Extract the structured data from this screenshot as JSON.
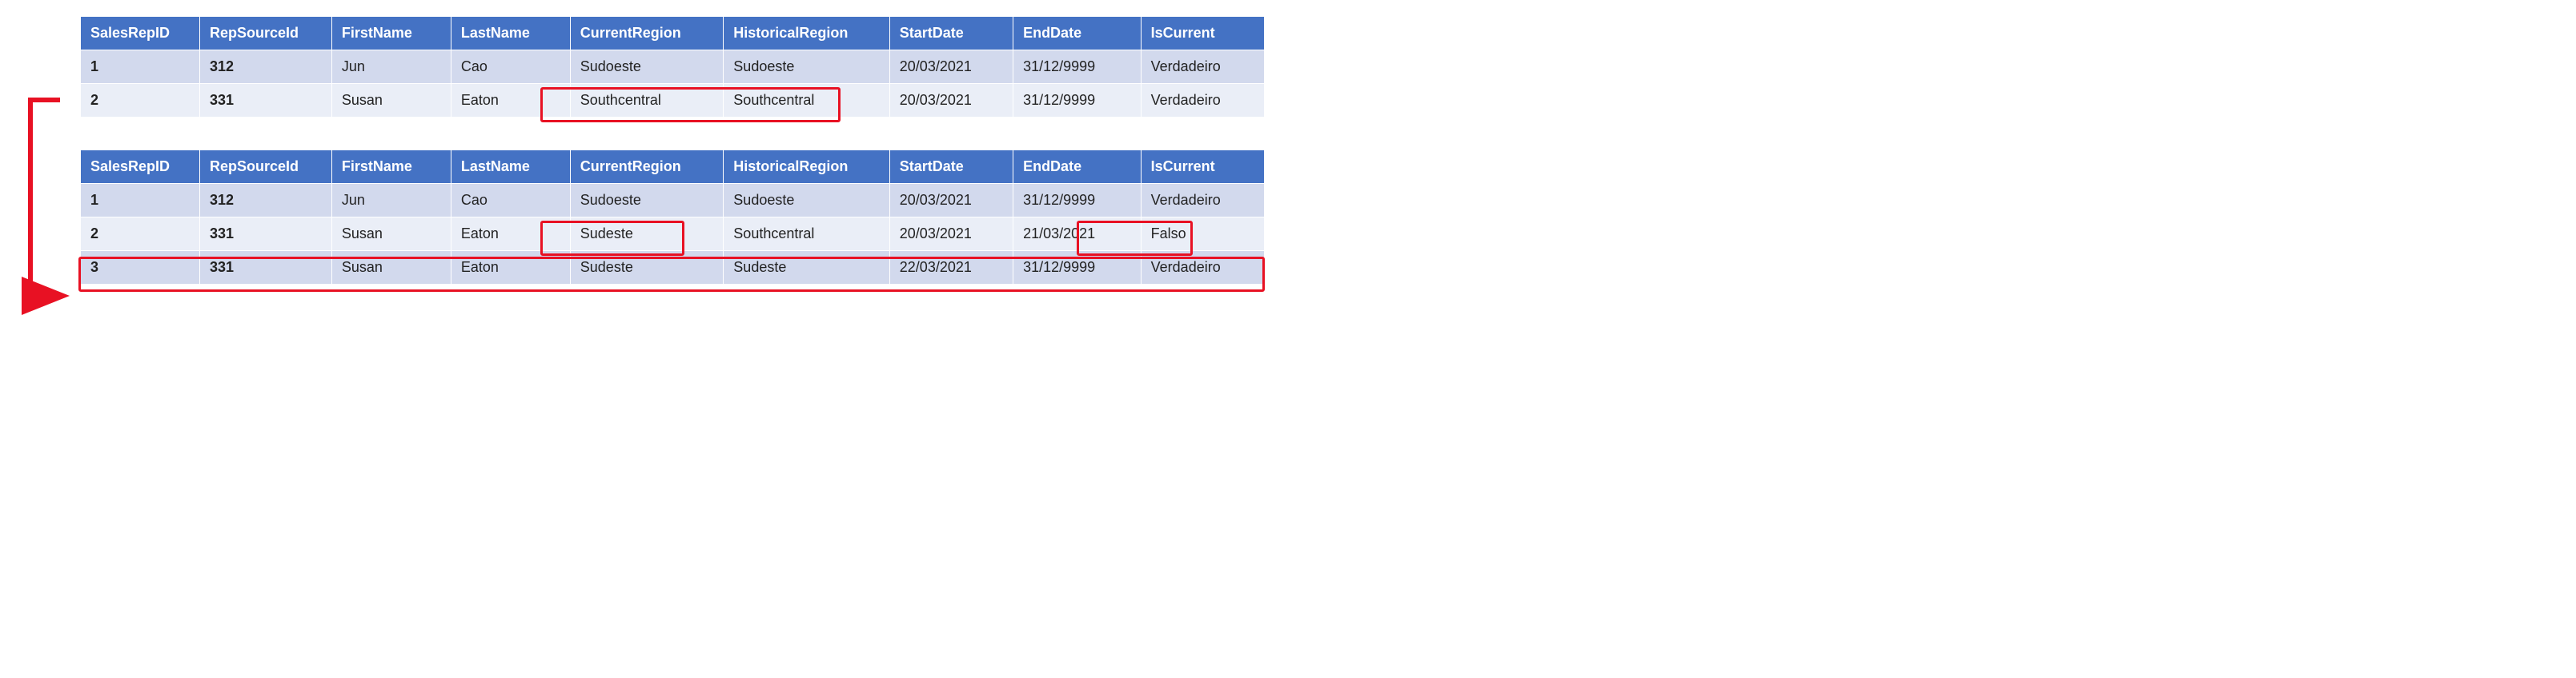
{
  "columns": [
    "SalesRepID",
    "RepSourceId",
    "FirstName",
    "LastName",
    "CurrentRegion",
    "HistoricalRegion",
    "StartDate",
    "EndDate",
    "IsCurrent"
  ],
  "table1": {
    "rows": [
      {
        "SalesRepID": "1",
        "RepSourceId": "312",
        "FirstName": "Jun",
        "LastName": "Cao",
        "CurrentRegion": "Sudoeste",
        "HistoricalRegion": "Sudoeste",
        "StartDate": "20/03/2021",
        "EndDate": "31/12/9999",
        "IsCurrent": "Verdadeiro"
      },
      {
        "SalesRepID": "2",
        "RepSourceId": "331",
        "FirstName": "Susan",
        "LastName": "Eaton",
        "CurrentRegion": "Southcentral",
        "HistoricalRegion": "Southcentral",
        "StartDate": "20/03/2021",
        "EndDate": "31/12/9999",
        "IsCurrent": "Verdadeiro"
      }
    ]
  },
  "table2": {
    "rows": [
      {
        "SalesRepID": "1",
        "RepSourceId": "312",
        "FirstName": "Jun",
        "LastName": "Cao",
        "CurrentRegion": "Sudoeste",
        "HistoricalRegion": "Sudoeste",
        "StartDate": "20/03/2021",
        "EndDate": "31/12/9999",
        "IsCurrent": "Verdadeiro"
      },
      {
        "SalesRepID": "2",
        "RepSourceId": "331",
        "FirstName": "Susan",
        "LastName": "Eaton",
        "CurrentRegion": "Sudeste",
        "HistoricalRegion": "Southcentral",
        "StartDate": "20/03/2021",
        "EndDate": "21/03/2021",
        "IsCurrent": "Falso"
      },
      {
        "SalesRepID": "3",
        "RepSourceId": "331",
        "FirstName": "Susan",
        "LastName": "Eaton",
        "CurrentRegion": "Sudeste",
        "HistoricalRegion": "Sudeste",
        "StartDate": "22/03/2021",
        "EndDate": "31/12/9999",
        "IsCurrent": "Verdadeiro"
      }
    ]
  },
  "highlights": {
    "t1_row2_regions": true,
    "t2_row2_current": true,
    "t2_row2_iscurrent": true,
    "t2_row3_full": true
  },
  "colors": {
    "header_bg": "#4472c4",
    "row_odd": "#d2d9ed",
    "row_even": "#eaeef7",
    "highlight": "#e81123",
    "arrow": "#e81123"
  }
}
